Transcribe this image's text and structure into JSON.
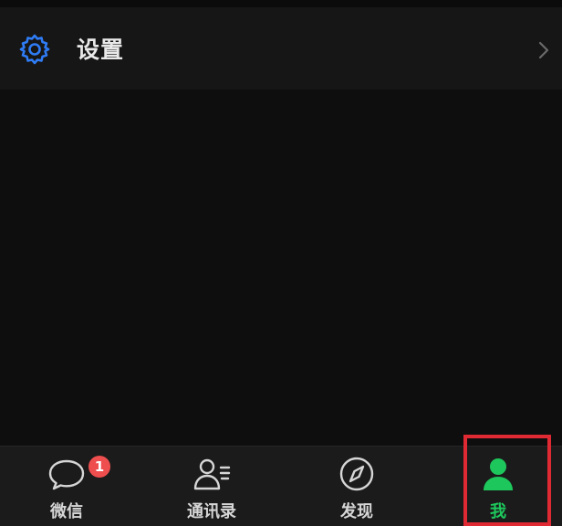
{
  "settings_row": {
    "icon": "gear-icon",
    "label": "设置",
    "chevron": "chevron-right-icon"
  },
  "tabbar": {
    "tabs": [
      {
        "label": "微信",
        "icon": "chat-bubble-icon",
        "badge": "1",
        "active": false
      },
      {
        "label": "通讯录",
        "icon": "contacts-icon",
        "active": false
      },
      {
        "label": "发现",
        "icon": "compass-icon",
        "active": false
      },
      {
        "label": "我",
        "icon": "person-icon",
        "active": true
      }
    ]
  },
  "colors": {
    "accent_active": "#1ec75c",
    "gear_blue": "#2f7cf6",
    "badge_red": "#ee4e4e",
    "highlight_red": "#e02a33"
  }
}
